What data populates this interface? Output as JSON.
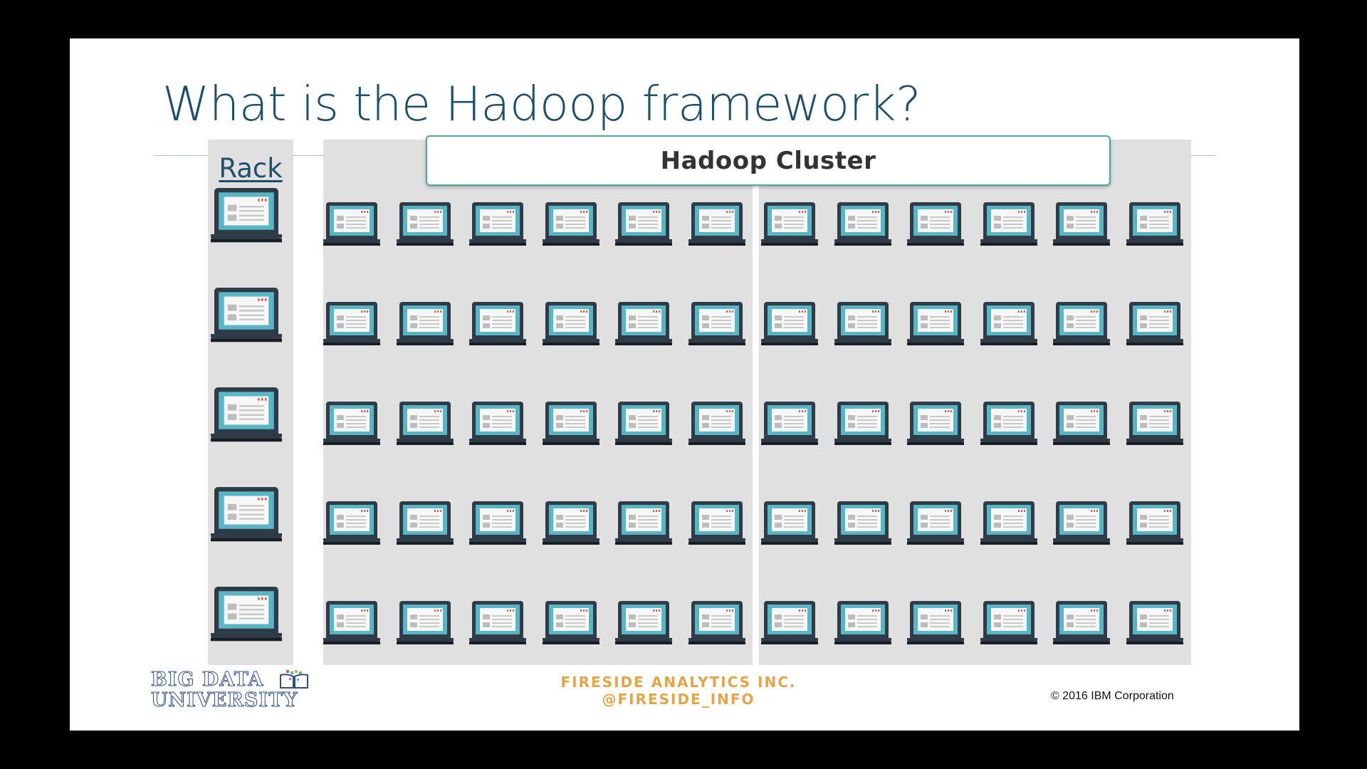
{
  "slide": {
    "title": "What is the Hadoop framework?",
    "rack_label": "Rack",
    "cluster_label": "Hadoop Cluster",
    "rack_laptop_count": 5,
    "cluster_laptop_rows": 5,
    "cluster_laptop_columns": 12
  },
  "footer": {
    "logo_line1": "BIG DATA",
    "logo_line2": "UNIVERSITY",
    "company_line1": "FIRESIDE ANALYTICS INC.",
    "company_line2": "@FIRESIDE_INFO",
    "copyright": "© 2016 IBM Corporation"
  },
  "colors": {
    "title": "#1f4e6b",
    "panel": "#e0e0e1",
    "screen": "#58b6c7",
    "laptop_body": "#2f3b47",
    "banner_border": "#4ea5a3",
    "fireside": "#e3a547",
    "logo": "#2d4f82"
  },
  "icons": {
    "node": "laptop-icon"
  }
}
